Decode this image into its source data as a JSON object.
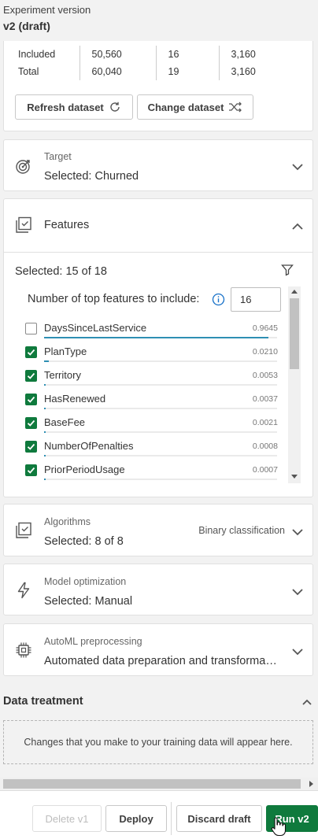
{
  "header": {
    "subtitle": "Experiment version",
    "version": "v2 (draft)"
  },
  "dataset_stats": {
    "rows": [
      {
        "label": "Included",
        "c1": "50,560",
        "c2": "16",
        "c3": "3,160"
      },
      {
        "label": "Total",
        "c1": "60,040",
        "c2": "19",
        "c3": "3,160"
      }
    ],
    "refresh_label": "Refresh dataset",
    "change_label": "Change dataset"
  },
  "target": {
    "label": "Target",
    "value": "Selected: Churned"
  },
  "features": {
    "title": "Features",
    "selected": "Selected: 15 of 18",
    "top_label": "Number of top features to include:",
    "top_value": "16",
    "items": [
      {
        "name": "DaysSinceLastService",
        "value": "0.9645",
        "checked": false,
        "importance": 0.9645
      },
      {
        "name": "PlanType",
        "value": "0.0210",
        "checked": true,
        "importance": 0.021
      },
      {
        "name": "Territory",
        "value": "0.0053",
        "checked": true,
        "importance": 0.0053
      },
      {
        "name": "HasRenewed",
        "value": "0.0037",
        "checked": true,
        "importance": 0.0037
      },
      {
        "name": "BaseFee",
        "value": "0.0021",
        "checked": true,
        "importance": 0.0021
      },
      {
        "name": "NumberOfPenalties",
        "value": "0.0008",
        "checked": true,
        "importance": 0.0008
      },
      {
        "name": "PriorPeriodUsage",
        "value": "0.0007",
        "checked": true,
        "importance": 0.0007
      }
    ]
  },
  "algorithms": {
    "label": "Algorithms",
    "value": "Selected: 8 of 8",
    "type": "Binary classification"
  },
  "optimization": {
    "label": "Model optimization",
    "value": "Selected: Manual"
  },
  "preprocessing": {
    "label": "AutoML preprocessing",
    "value": "Automated data preparation and transforma…"
  },
  "data_treatment": {
    "title": "Data treatment",
    "message": "Changes that you make to your training data will appear here."
  },
  "footer": {
    "delete_label": "Delete v1",
    "deploy_label": "Deploy",
    "discard_label": "Discard draft",
    "run_label": "Run v2"
  },
  "colors": {
    "accent_green": "#0f7a3d",
    "bar_blue": "#2e8fb3",
    "info_blue": "#1a73c9"
  }
}
